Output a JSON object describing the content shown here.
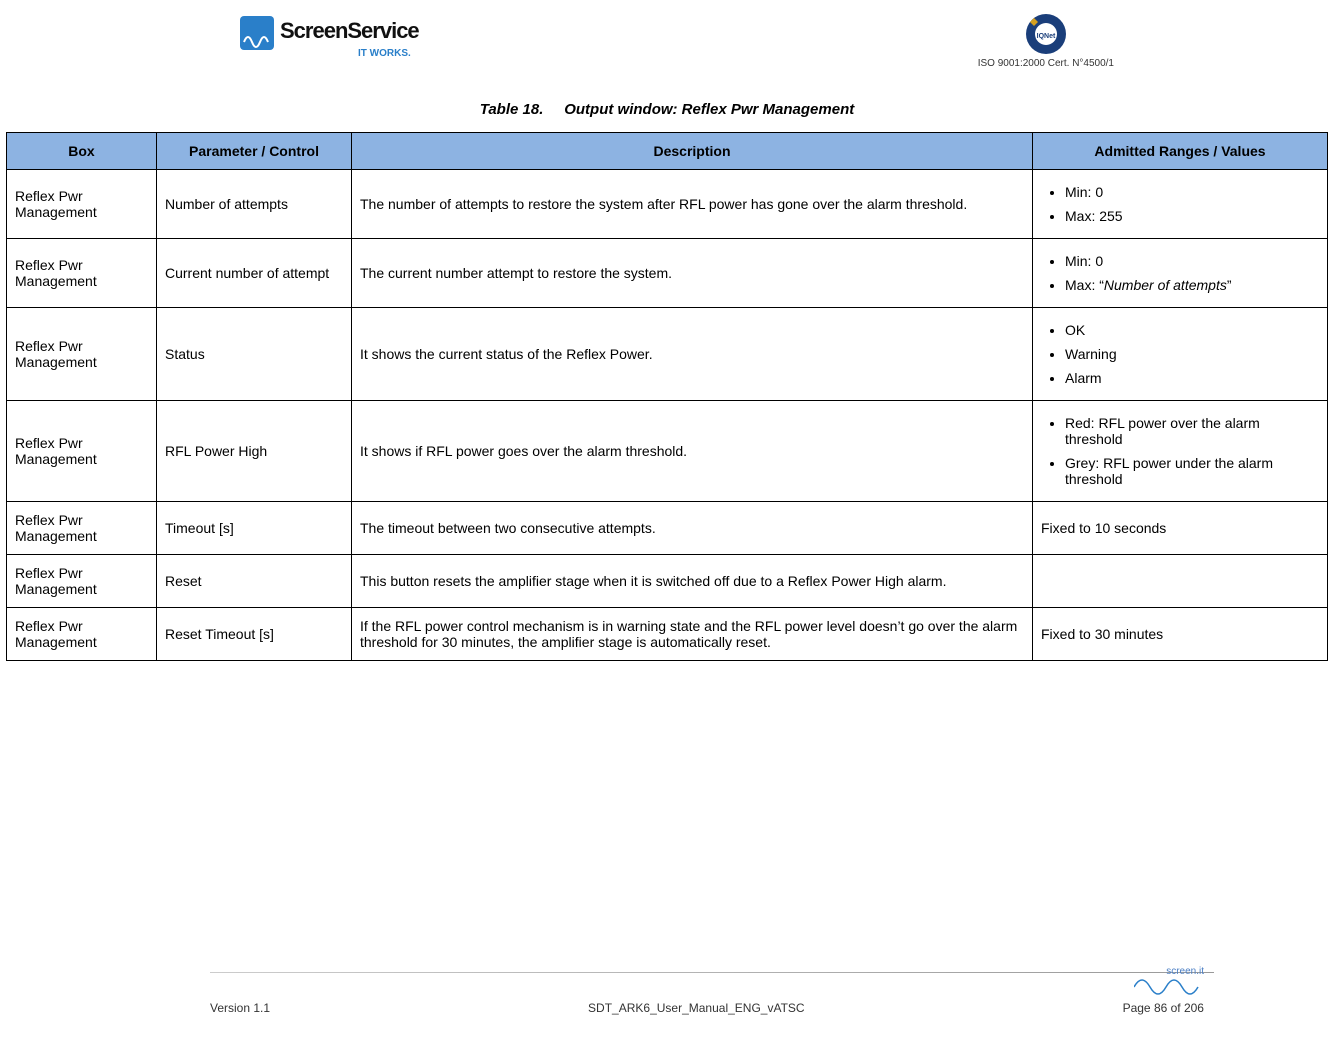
{
  "header": {
    "logo_text_top": "ScreenService",
    "logo_text_bottom": "IT WORKS.",
    "cert_text": "ISO 9001:2000 Cert. N°4500/1"
  },
  "title": {
    "prefix": "Table 18.",
    "main": "Output window: Reflex Pwr Management"
  },
  "columns": {
    "box": "Box",
    "param": "Parameter / Control",
    "desc": "Description",
    "ranges": "Admitted Ranges / Values"
  },
  "rows": [
    {
      "box": "Reflex Pwr Management",
      "param": "Number of attempts",
      "desc": "The number of attempts to restore the system after RFL power has gone over the alarm threshold.",
      "ranges_list": [
        "Min: 0",
        "Max: 255"
      ]
    },
    {
      "box": "Reflex Pwr Management",
      "param": "Current number of attempt",
      "desc": "The current number attempt to restore the system.",
      "ranges_list": [
        "Min: 0",
        "Max: “<i>Number of attempts</i>”"
      ]
    },
    {
      "box": "Reflex Pwr Management",
      "param": "Status",
      "desc": "It shows the current status of the Reflex Power.",
      "ranges_list": [
        "OK",
        "Warning",
        "Alarm"
      ]
    },
    {
      "box": "Reflex Pwr Management",
      "param": "RFL Power High",
      "desc": "It shows if RFL power goes over the alarm threshold.",
      "ranges_list": [
        "Red: RFL power over the alarm threshold",
        "Grey: RFL power under the alarm threshold"
      ]
    },
    {
      "box": "Reflex Pwr Management",
      "param": "Timeout [s]",
      "desc": "The timeout between two consecutive attempts.",
      "ranges_text": "Fixed to 10 seconds"
    },
    {
      "box": "Reflex Pwr Management",
      "param": "Reset",
      "desc": "This button resets the amplifier stage when it is switched off due to a Reflex Power High alarm.",
      "ranges_text": ""
    },
    {
      "box": "Reflex Pwr Management",
      "param": "Reset Timeout [s]",
      "desc": "If the RFL power control mechanism is in warning state and the RFL power level doesn’t go over the alarm threshold for 30 minutes, the amplifier stage is automatically reset.",
      "ranges_text": "Fixed to 30 minutes"
    }
  ],
  "footer": {
    "version": "Version 1.1",
    "docname": "SDT_ARK6_User_Manual_ENG_vATSC",
    "page": "Page 86 of 206",
    "brand": "screen.it"
  }
}
